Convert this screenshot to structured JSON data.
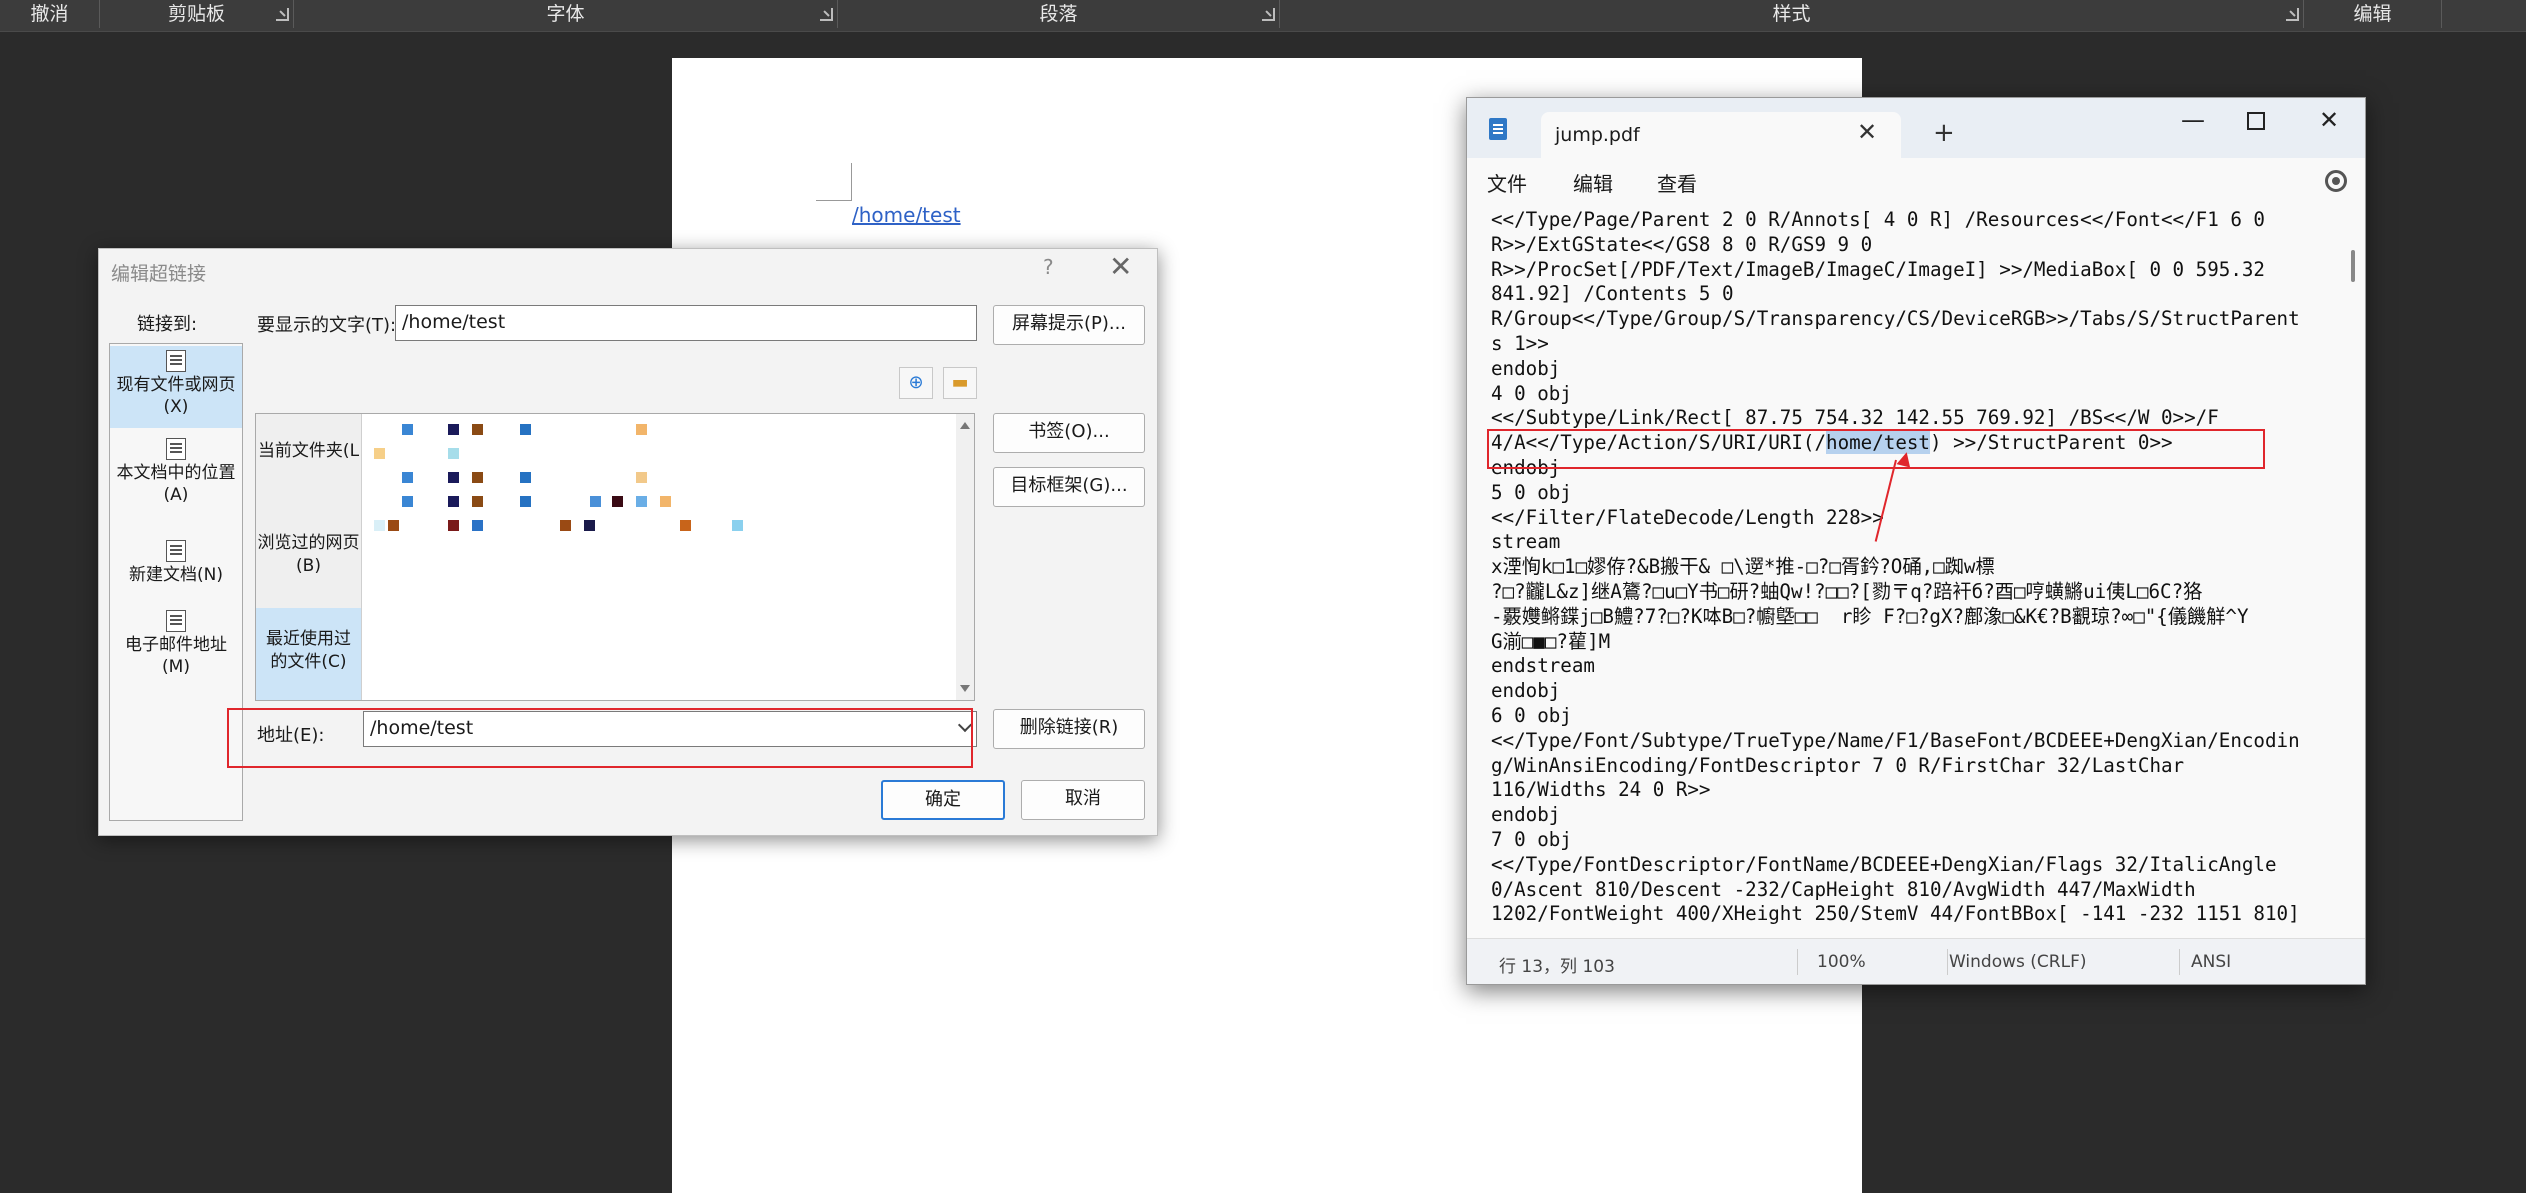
{
  "ribbon": {
    "groups": [
      "撤消",
      "剪贴板",
      "字体",
      "段落",
      "样式",
      "编辑"
    ]
  },
  "document": {
    "link_text": "/home/test"
  },
  "dialog": {
    "title": "编辑超链接",
    "help": "?",
    "link_to_label": "链接到:",
    "nav": [
      {
        "label": "现有文件或网页(X)",
        "icon": "web-page-icon",
        "selected": true
      },
      {
        "label": "本文档中的位置(A)",
        "icon": "document-place-icon",
        "selected": false
      },
      {
        "label": "新建文档(N)",
        "icon": "new-document-icon",
        "selected": false
      },
      {
        "label": "电子邮件地址(M)",
        "icon": "email-icon",
        "selected": false
      }
    ],
    "display_text_label": "要显示的文字(T):",
    "display_text_value": "/home/test",
    "screentip_button": "屏幕提示(P)...",
    "categories": [
      {
        "label": "当前文件夹(L",
        "selected": false
      },
      {
        "label": "浏览过的网页(B)",
        "selected": false
      },
      {
        "label": "最近使用过的文件(C)",
        "selected": true
      }
    ],
    "bookmark_button": "书签(O)...",
    "target_frame_button": "目标框架(G)...",
    "address_label": "地址(E):",
    "address_value": "/home/test",
    "remove_link_button": "删除链接(R)",
    "ok_button": "确定",
    "cancel_button": "取消"
  },
  "notepad": {
    "tab_title": "jump.pdf",
    "menu": [
      "文件",
      "编辑",
      "查看"
    ],
    "lines_before": [
      "<</Type/Page/Parent 2 0 R/Annots[ 4 0 R] /Resources<</Font<</F1 6 0",
      "R>>/ExtGState<</GS8 8 0 R/GS9 9 0",
      "R>>/ProcSet[/PDF/Text/ImageB/ImageC/ImageI] >>/MediaBox[ 0 0 595.32",
      "841.92] /Contents 5 0",
      "R/Group<</Type/Group/S/Transparency/CS/DeviceRGB>>/Tabs/S/StructParent",
      "s 1>>",
      "endobj",
      "4 0 obj",
      "<</Subtype/Link/Rect[ 87.75 754.32 142.55 769.92] /BS<</W 0>>/F"
    ],
    "line_hl_prefix": "4/A<</Type/Action/S/URI/URI(/",
    "line_hl_selected": "home/test",
    "line_hl_suffix": ") >>/StructParent 0>>",
    "lines_after": [
      "endobj",
      "5 0 obj",
      "<</Filter/FlateDecode/Length 228>>",
      "stream",
      "x湮恂k□1□嫪侟?&B搬干& □\\遻*推-□?□胥鈐?O硧,□踟w標",
      "?□?龖L&z]继A鷟?□u□Y书□研?蚰Qw!?□□?[勠〒q?踣衦б?酉□哼蟥鱂ui侇L□6C?狢",
      "-覈孇鳉鍱j□B鱧?7?□?K呠B□?幮墍□□  r眕 F?□?gX?鄜潒□&K€?B覾琼?∞□\"{儀饑觧^Y",
      "G湔□■□?雚]M",
      "endstream",
      "endobj",
      "6 0 obj",
      "<</Type/Font/Subtype/TrueType/Name/F1/BaseFont/BCDEEE+DengXian/Encodin",
      "g/WinAnsiEncoding/FontDescriptor 7 0 R/FirstChar 32/LastChar",
      "116/Widths 24 0 R>>",
      "endobj",
      "7 0 obj",
      "<</Type/FontDescriptor/FontName/BCDEEE+DengXian/Flags 32/ItalicAngle",
      "0/Ascent 810/Descent -232/CapHeight 810/AvgWidth 447/MaxWidth",
      "1202/FontWeight 400/XHeight 250/StemV 44/FontBBox[ -141 -232 1151 810]"
    ],
    "status": {
      "position": "行 13，列 103",
      "zoom": "100%",
      "line_ending": "Windows (CRLF)",
      "encoding": "ANSI"
    }
  },
  "colors": {
    "accent": "#2a7ad6",
    "annotation_red": "#e0262c",
    "selection": "#b6d1ee"
  }
}
